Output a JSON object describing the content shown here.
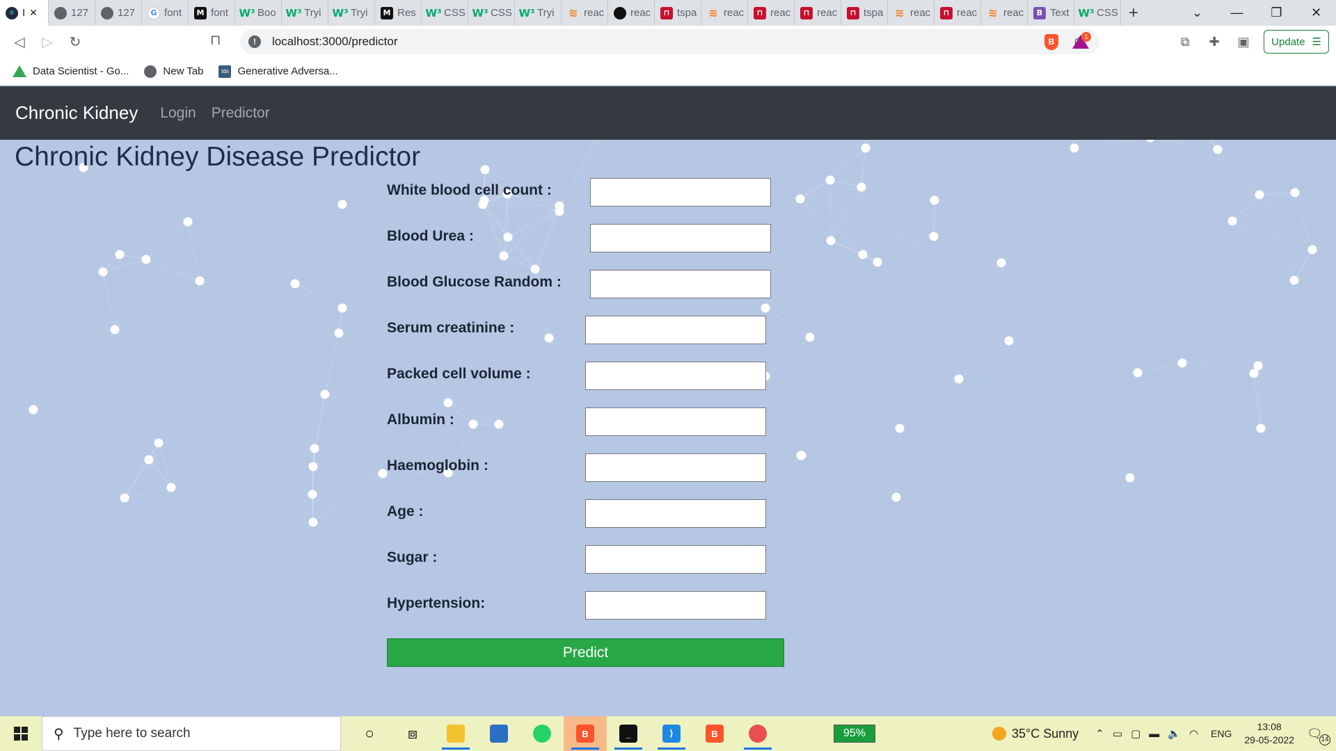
{
  "browser": {
    "tabs": [
      {
        "icon": "react-icon",
        "label": "I",
        "active": true
      },
      {
        "icon": "globe-icon",
        "label": "127"
      },
      {
        "icon": "globe-icon",
        "label": "127"
      },
      {
        "icon": "google-icon",
        "label": "font"
      },
      {
        "icon": "medium-icon",
        "label": "font"
      },
      {
        "icon": "w3schools-icon",
        "label": "Boo"
      },
      {
        "icon": "w3schools-icon",
        "label": "Tryi"
      },
      {
        "icon": "w3schools-icon",
        "label": "Tryi"
      },
      {
        "icon": "medium-icon",
        "label": "Res"
      },
      {
        "icon": "w3schools-icon",
        "label": "CSS"
      },
      {
        "icon": "w3schools-icon",
        "label": "CSS"
      },
      {
        "icon": "w3schools-icon",
        "label": "Tryi"
      },
      {
        "icon": "stackoverflow-icon",
        "label": "reac"
      },
      {
        "icon": "github-icon",
        "label": "reac"
      },
      {
        "icon": "tutorialspoint-icon",
        "label": "tspa"
      },
      {
        "icon": "stackoverflow-icon",
        "label": "reac"
      },
      {
        "icon": "tutorialspoint-icon",
        "label": "reac"
      },
      {
        "icon": "tutorialspoint-icon",
        "label": "reac"
      },
      {
        "icon": "tutorialspoint-icon",
        "label": "tspa"
      },
      {
        "icon": "stackoverflow-icon",
        "label": "reac"
      },
      {
        "icon": "tutorialspoint-icon",
        "label": "reac"
      },
      {
        "icon": "stackoverflow-icon",
        "label": "reac"
      },
      {
        "icon": "bootstrap-icon",
        "label": "Text"
      },
      {
        "icon": "w3schools-icon",
        "label": "CSS"
      }
    ],
    "url": "localhost:3000/predictor",
    "update_label": "Update",
    "reward_count": "1",
    "bookmarks": [
      {
        "icon": "google-drive-icon",
        "label": "Data Scientist - Go..."
      },
      {
        "icon": "globe-icon",
        "label": "New Tab"
      },
      {
        "icon": "tds-icon",
        "label": "Generative Adversa..."
      }
    ]
  },
  "app": {
    "brand": "Chronic Kidney",
    "nav_links": [
      "Login",
      "Predictor"
    ],
    "title": "Chronic Kidney Disease Predictor",
    "fields": [
      {
        "label": "White blood cell count :",
        "value": ""
      },
      {
        "label": "Blood Urea :",
        "value": ""
      },
      {
        "label": "Blood Glucose Random :",
        "value": ""
      },
      {
        "label": "Serum creatinine :",
        "value": ""
      },
      {
        "label": "Packed cell volume :",
        "value": ""
      },
      {
        "label": "Albumin :",
        "value": ""
      },
      {
        "label": "Haemoglobin :",
        "value": ""
      },
      {
        "label": "Age :",
        "value": ""
      },
      {
        "label": "Sugar :",
        "value": ""
      },
      {
        "label": "Hypertension:",
        "value": ""
      }
    ],
    "predict_label": "Predict"
  },
  "taskbar": {
    "search_placeholder": "Type here to search",
    "battery": "95%",
    "weather": "35°C  Sunny",
    "language": "ENG",
    "time": "13:08",
    "date": "29-05-2022",
    "notification_count": "14"
  },
  "colors": {
    "page_bg": "#b6c7e4",
    "navbar_bg": "#343a40",
    "predict_btn": "#28a745",
    "particle": "#ffffff"
  }
}
